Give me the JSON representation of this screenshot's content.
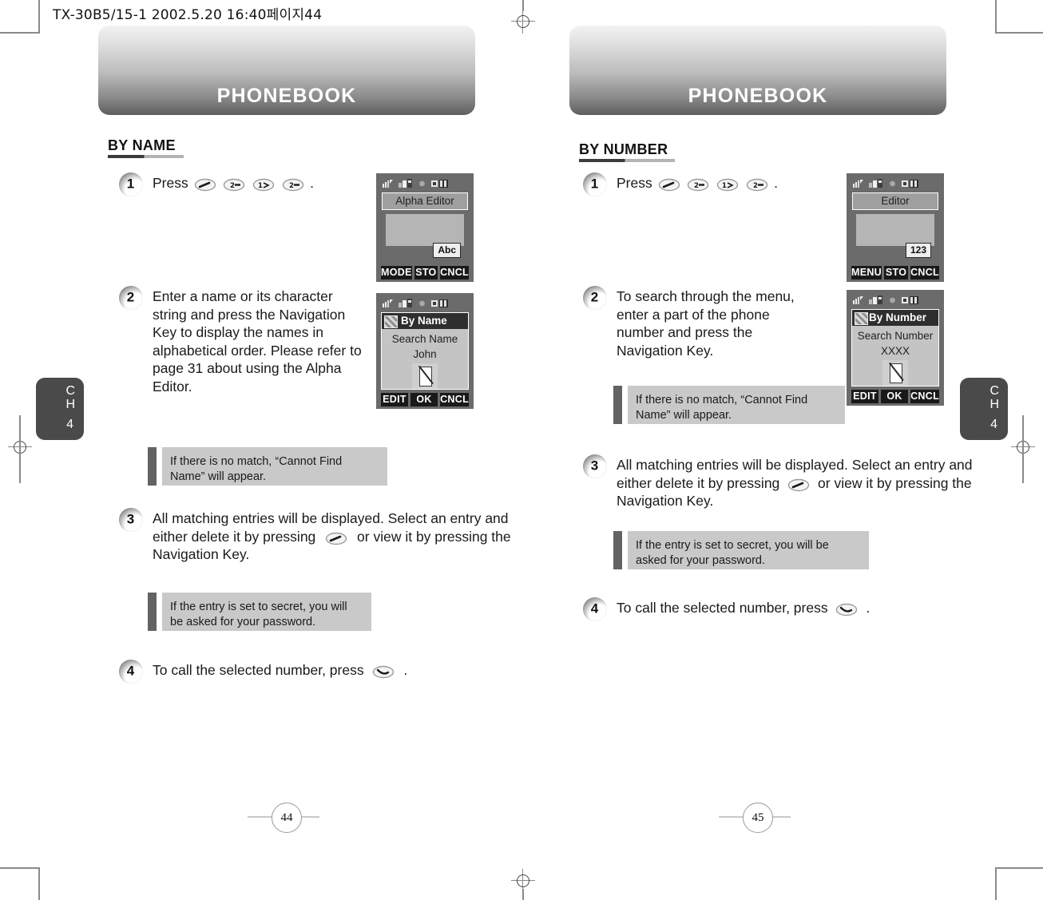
{
  "slug": "TX-30B5/15-1  2002.5.20 16:40페이지44",
  "pages": [
    {
      "banner_title": "PHONEBOOK",
      "section": "BY NAME",
      "page_number": "44",
      "chapter": {
        "ch": "C\nH",
        "number": "4"
      },
      "steps": [
        {
          "num": "1",
          "text_before": "Press",
          "keys": [
            "send-key-icon",
            "nav-key-icon",
            "menu-key-icon",
            "nav-key-icon"
          ],
          "text_after": "."
        },
        {
          "num": "2",
          "text": "Enter a name or its character string and press the Navigation Key to display the names in alphabetical order. Please refer to page 31 about using the Alpha Editor."
        },
        {
          "num": "3",
          "text_before": "All matching entries will be displayed. Select an entry and either delete it by pressing",
          "inline_key": "send-key-icon",
          "text_after": "or view it by pressing the Navigation Key."
        },
        {
          "num": "4",
          "text_before": "To call the selected number, press",
          "inline_key": "send-key-icon",
          "text_after": "."
        }
      ],
      "notes": [
        "If there is no match, “Cannot Find Name” will appear.",
        "If the entry is set to secret, you will be asked for your password."
      ],
      "screens": [
        {
          "title": "Alpha Editor",
          "title_style": "plain",
          "content": [],
          "mode_badge": "Abc",
          "softkeys": [
            "MODE",
            "STO",
            "CNCL"
          ]
        },
        {
          "title": "By Name",
          "title_style": "dark",
          "content": [
            "Search Name",
            "John"
          ],
          "mode_badge": "",
          "softkeys": [
            "EDIT",
            "OK",
            "CNCL"
          ]
        }
      ]
    },
    {
      "banner_title": "PHONEBOOK",
      "section": "BY NUMBER",
      "page_number": "45",
      "chapter": {
        "ch": "C\nH",
        "number": "4"
      },
      "steps": [
        {
          "num": "1",
          "text_before": "Press",
          "keys": [
            "send-key-icon",
            "nav-key-icon",
            "menu-key-icon",
            "nav-key-icon"
          ],
          "text_after": "."
        },
        {
          "num": "2",
          "text": "To search through the menu, enter a part of the phone number and press the Navigation Key."
        },
        {
          "num": "3",
          "text_before": "All matching entries will be displayed. Select an entry and either delete it by pressing",
          "inline_key": "send-key-icon",
          "text_after": "or view it by pressing the Navigation Key."
        },
        {
          "num": "4",
          "text_before": "To call the selected number, press",
          "inline_key": "send-key-icon",
          "text_after": "."
        }
      ],
      "notes": [
        "If there is no match, “Cannot Find Name” will appear.",
        "If the entry is set to secret, you will be asked for your password."
      ],
      "screens": [
        {
          "title": "Editor",
          "title_style": "plain",
          "content": [],
          "mode_badge": "123",
          "softkeys": [
            "MENU",
            "STO",
            "CNCL"
          ]
        },
        {
          "title": "By Number",
          "title_style": "dark",
          "content": [
            "Search Number",
            "XXXX"
          ],
          "mode_badge": "",
          "softkeys": [
            "EDIT",
            "OK",
            "CNCL"
          ]
        }
      ]
    }
  ],
  "colors": {
    "banner_top": "#f2f2f2",
    "banner_bottom": "#5e5e5e",
    "note_bar": "#636363",
    "note_bg": "#c9c9c9",
    "phone_body": "#6b6b6b",
    "lcd_bg": "#c4c4c4",
    "softkey_bg": "#191919",
    "chapter_tab": "#4a4a4a"
  }
}
